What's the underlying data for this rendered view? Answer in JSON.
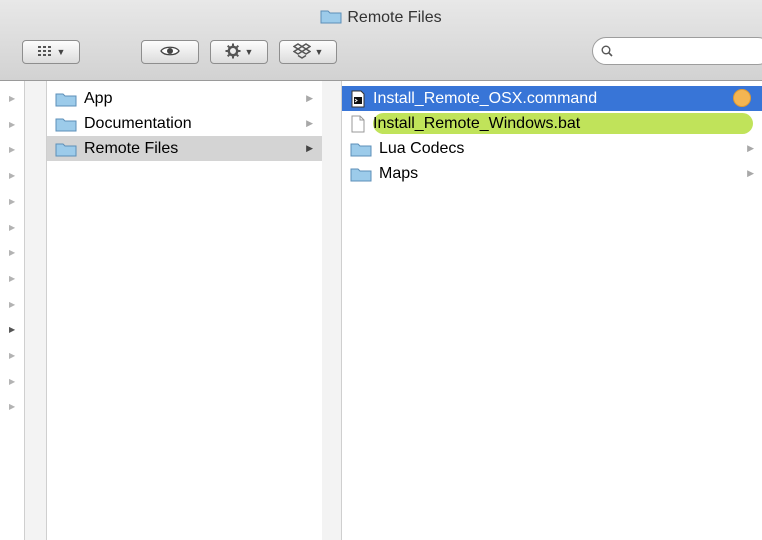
{
  "window": {
    "title": "Remote Files"
  },
  "toolbar": {
    "view_button": "view-options",
    "quicklook_button": "quick-look",
    "action_button": "action",
    "dropbox_button": "dropbox",
    "search_placeholder": ""
  },
  "column0": {
    "arrow_count": 13,
    "active_arrow_index": 9
  },
  "column1": {
    "items": [
      {
        "label": "App",
        "icon": "folder-icon",
        "has_children": true,
        "selected": false
      },
      {
        "label": "Documentation",
        "icon": "folder-icon",
        "has_children": true,
        "selected": false
      },
      {
        "label": "Remote Files",
        "icon": "folder-icon",
        "has_children": true,
        "selected": true
      }
    ]
  },
  "column2": {
    "items": [
      {
        "label": "Install_Remote_OSX.command",
        "icon": "executable-file-icon",
        "selected": true,
        "tag_color": "#f3b552"
      },
      {
        "label": "Install_Remote_Windows.bat",
        "icon": "document-icon",
        "label_color": "#c0e35a"
      },
      {
        "label": "Lua Codecs",
        "icon": "folder-icon",
        "has_children": true
      },
      {
        "label": "Maps",
        "icon": "folder-icon",
        "has_children": true
      }
    ]
  },
  "colors": {
    "selection_blue": "#3875d7",
    "selection_gray": "#d4d4d4",
    "folder_blue": "#9ccbea"
  }
}
